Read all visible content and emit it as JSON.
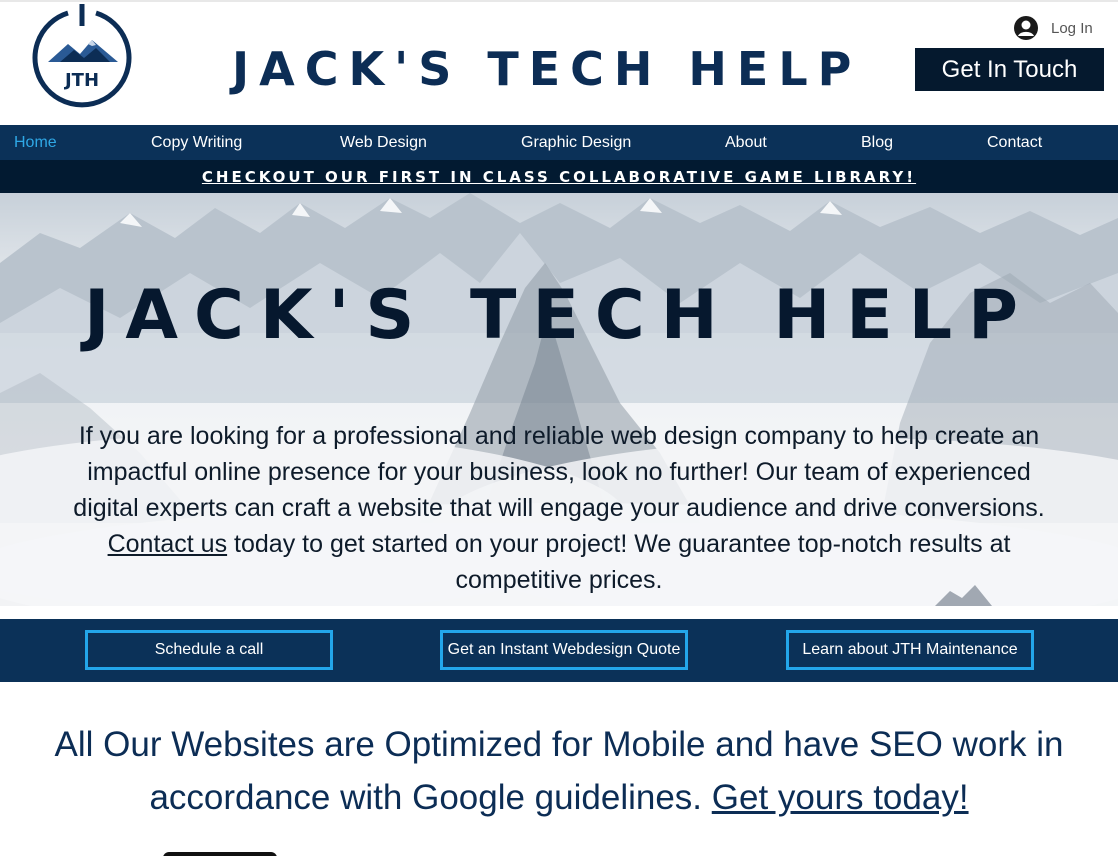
{
  "header": {
    "logo_text": "JTH",
    "site_title": "JACK'S TECH HELP",
    "login_label": "Log In",
    "cta_label": "Get In Touch"
  },
  "nav": {
    "items": [
      {
        "label": "Home",
        "active": true
      },
      {
        "label": "Copy Writing"
      },
      {
        "label": "Web Design"
      },
      {
        "label": "Graphic Design"
      },
      {
        "label": "About"
      },
      {
        "label": "Blog"
      },
      {
        "label": "Contact"
      }
    ]
  },
  "promo": {
    "label": "CHECKOUT OUR FIRST IN CLASS COLLABORATIVE GAME LIBRARY!"
  },
  "hero": {
    "title": "JACK'S TECH HELP",
    "text_before": "If you are looking for a professional and reliable web design company to help create an impactful online presence for your business, look no further! Our team of experienced digital experts can craft a website that will engage your audience and drive conversions. ",
    "link": "Contact us",
    "text_after": " today to get started on your project! We guarantee top-notch results at competitive prices."
  },
  "actions": {
    "schedule": "Schedule a call",
    "quote": "Get an Instant Webdesign Quote",
    "maintenance": "Learn about JTH Maintenance"
  },
  "seo": {
    "text": "All Our Websites are Optimized for Mobile and have SEO work in accordance with Google guidelines. ",
    "link": "Get yours today!"
  },
  "colors": {
    "brand_navy": "#0b3158",
    "dark_navy": "#05192e",
    "accent_blue": "#23a6ea",
    "active_nav": "#2fa8e6"
  },
  "icons": {
    "logo": "mountain-power-logo",
    "login": "user-avatar-icon"
  }
}
